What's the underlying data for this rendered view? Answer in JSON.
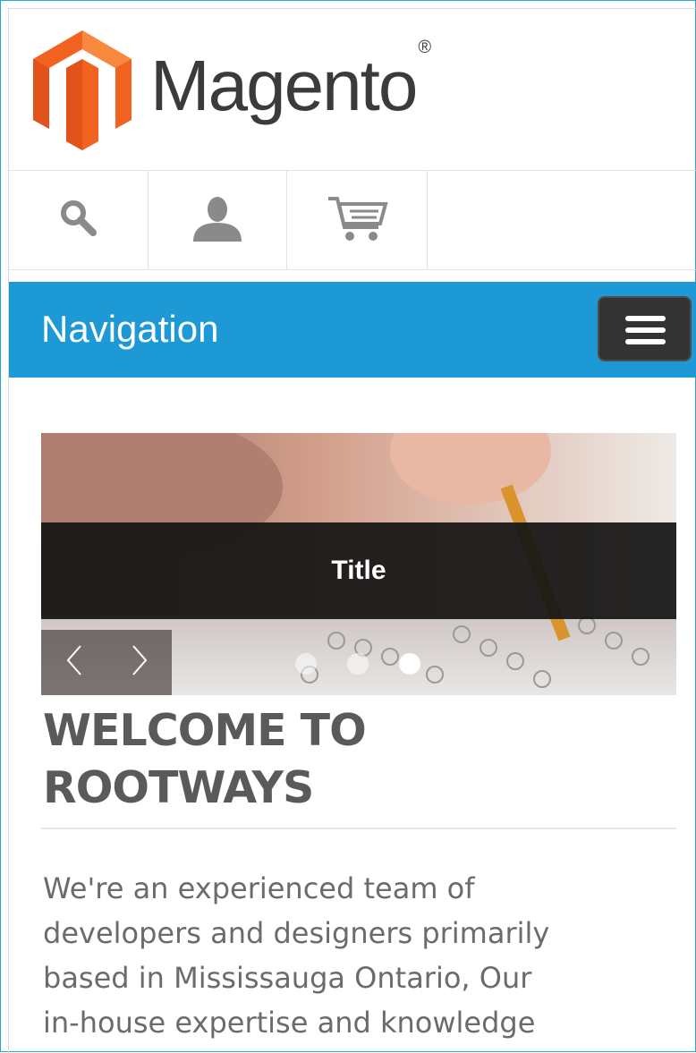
{
  "header": {
    "logo_text": "Magento",
    "logo_registered": "®",
    "logo_icon": "magento-logo-icon"
  },
  "icon_bar": {
    "items": [
      {
        "icon": "search-icon"
      },
      {
        "icon": "user-icon"
      },
      {
        "icon": "cart-icon"
      }
    ]
  },
  "navigation": {
    "title": "Navigation",
    "menu_icon": "hamburger-icon"
  },
  "slider": {
    "caption": "Title",
    "prev_icon": "chevron-left-icon",
    "next_icon": "chevron-right-icon",
    "dots": [
      {
        "active": false
      },
      {
        "active": false
      },
      {
        "active": true
      }
    ]
  },
  "content": {
    "heading_line1": "WELCOME TO",
    "heading_line2": "ROOTWAYS",
    "paragraph_line1": "We're an experienced team of",
    "paragraph_line2": "developers and designers primarily",
    "paragraph_line3": "based in Mississauga Ontario, Our",
    "paragraph_line4": "in-house expertise and knowledge"
  },
  "colors": {
    "nav_blue": "#1d9ad6",
    "logo_orange": "#f26322",
    "heading_gray": "#5a5a5a",
    "text_gray": "#6b6b6b"
  }
}
